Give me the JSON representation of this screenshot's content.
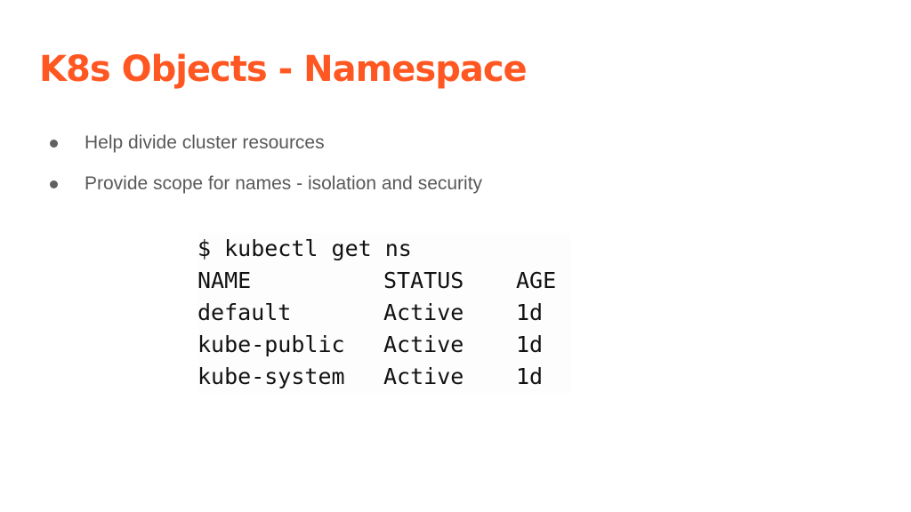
{
  "slide": {
    "title": "K8s Objects - Namespace",
    "bullets": [
      "Help divide cluster resources",
      "Provide scope for names - isolation and security"
    ]
  },
  "terminal": {
    "command": "$ kubectl get ns",
    "headers": [
      "NAME",
      "STATUS",
      "AGE"
    ],
    "rows": [
      [
        "default",
        "Active",
        "1d"
      ],
      [
        "kube-public",
        "Active",
        "1d"
      ],
      [
        "kube-system",
        "Active",
        "1d"
      ]
    ]
  },
  "colors": {
    "title": "#ff5722",
    "bullet_text": "#595959",
    "terminal_text": "#111111"
  }
}
